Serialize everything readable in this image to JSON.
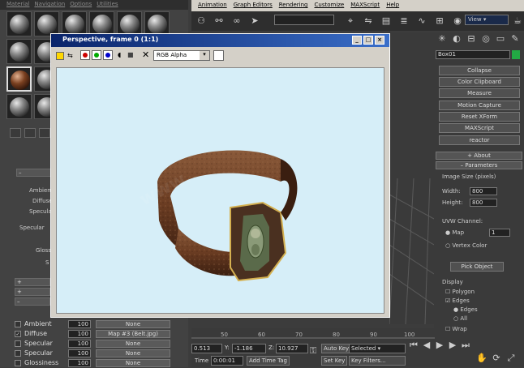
{
  "material_editor": {
    "menu": [
      "Material",
      "Navigation",
      "Options",
      "Utilities"
    ],
    "labels": {
      "ambient": "Ambient",
      "diffuse": "Diffuse",
      "specular": "Specular",
      "specular_level": "Specular",
      "glossiness": "Gloss",
      "soften": "S"
    },
    "maps": [
      {
        "checked": false,
        "name": "Ambient",
        "amount": "100",
        "map": "None"
      },
      {
        "checked": true,
        "name": "Diffuse",
        "amount": "100",
        "map": "Map #3 (Belt.jpg)"
      },
      {
        "checked": false,
        "name": "Specular",
        "amount": "100",
        "map": "None"
      },
      {
        "checked": false,
        "name": "Specular",
        "amount": "100",
        "map": "None"
      },
      {
        "checked": false,
        "name": "Glossiness",
        "amount": "100",
        "map": "None"
      }
    ],
    "check_glyph": "✓"
  },
  "main_menu": [
    "Animation",
    "Graph Editors",
    "Rendering",
    "Customize",
    "MAXScript",
    "Help"
  ],
  "toolbar": {
    "view_label": "View"
  },
  "render_window": {
    "title": "Perspective, frame 0 (1:1)",
    "channel": "RGB Alpha",
    "channel_colors": [
      "#cc0000",
      "#00aa00",
      "#0000cc"
    ]
  },
  "command_panel": {
    "object_name": "Box01",
    "object_color": "#22aa44",
    "utilities": [
      "Collapse",
      "Color Clipboard",
      "Measure",
      "Motion Capture",
      "Reset XForm",
      "MAXScript",
      "reactor"
    ],
    "about": "About",
    "parameters": "Parameters",
    "image_size": "Image Size (pixels)",
    "width_label": "Width:",
    "width_value": "800",
    "height_label": "Height:",
    "height_value": "800",
    "uvw_channel": "UVW Channel:",
    "map_label": "Map",
    "map_value": "1",
    "vertex_color": "Vertex Color",
    "pick_object": "Pick Object",
    "display": "Display",
    "display_polygon": "Polygon",
    "display_edges": "Edges",
    "display_sub_edges": "Edges",
    "display_all": "All",
    "display_wrap": "Wrap"
  },
  "timeline": {
    "ticks": [
      "50",
      "60",
      "70",
      "80",
      "90",
      "100"
    ],
    "x_value": "0.513",
    "y_label": "Y:",
    "y_value": "-1.186",
    "z_label": "Z:",
    "z_value": "10.927",
    "auto_key": "Auto Key",
    "selected": "Selected",
    "set_key": "Set Key",
    "key_filters": "Key Filters...",
    "time_label": "Time",
    "time_value": "0:00:01",
    "add_time_tag": "Add Time Tag"
  }
}
